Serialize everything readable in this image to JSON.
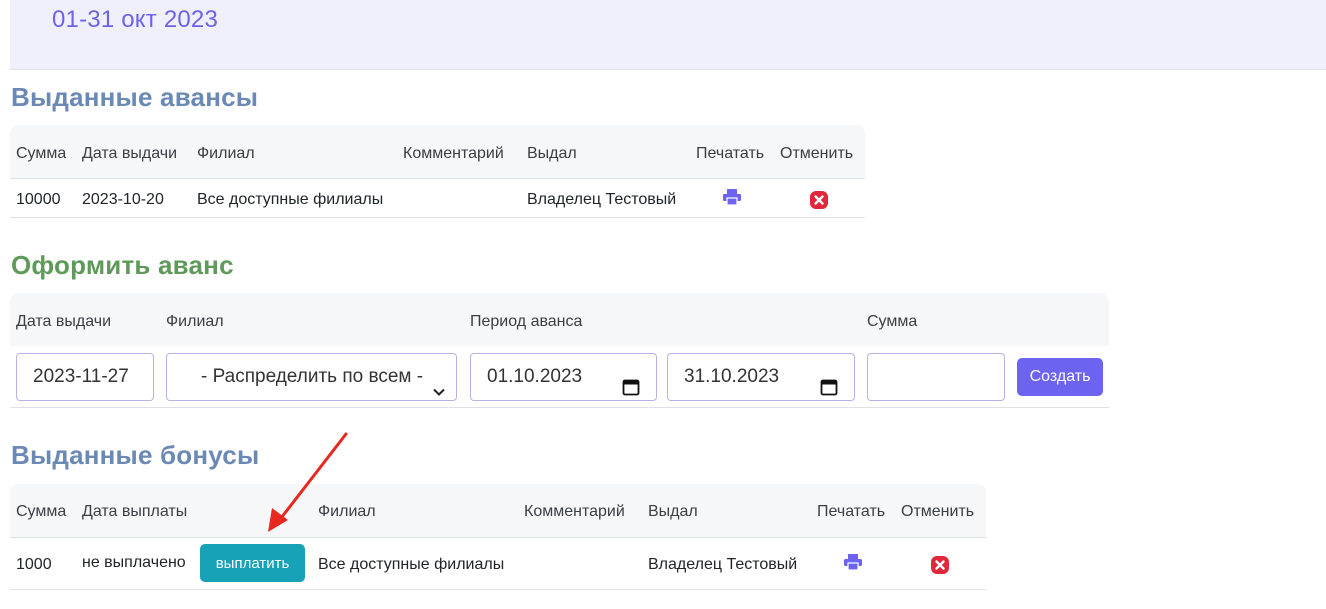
{
  "period": {
    "title": "01-31 окт 2023"
  },
  "advances_issued": {
    "title": "Выданные авансы",
    "columns": [
      "Сумма",
      "Дата выдачи",
      "Филиал",
      "Комментарий",
      "Выдал",
      "Печатать",
      "Отменить"
    ],
    "rows": [
      {
        "amount": "10000",
        "date": "2023-10-20",
        "branch": "Все доступные филиалы",
        "comment": "",
        "issued_by": "Владелец Тестовый",
        "print_icon": "print-icon",
        "cancel_icon": "cancel-icon"
      }
    ]
  },
  "create_advance": {
    "title": "Оформить аванс",
    "columns": [
      "Дата выдачи",
      "Филиал",
      "Период аванса",
      "Сумма"
    ],
    "date_value": "2023-11-27",
    "branch_selected": "- Распределить по всем -",
    "period_from": "01.10.2023",
    "period_to": "31.10.2023",
    "amount_value": "",
    "submit_label": "Создать"
  },
  "bonuses_issued": {
    "title": "Выданные бонусы",
    "columns": [
      "Сумма",
      "Дата выплаты",
      "Филиал",
      "Комментарий",
      "Выдал",
      "Печатать",
      "Отменить"
    ],
    "rows": [
      {
        "amount": "1000",
        "status": "не выплачено",
        "pay_label": "выплатить",
        "branch": "Все доступные филиалы",
        "comment": "",
        "issued_by": "Владелец Тестовый",
        "print_icon": "print-icon",
        "cancel_icon": "cancel-icon"
      }
    ]
  },
  "colors": {
    "accent": "#6c63f0",
    "title_blue": "#6a89b4",
    "title_green": "#5f9a5a",
    "pay_button": "#17a2b8",
    "cancel_red": "#e0283a",
    "annotation_arrow": "#e8271f"
  }
}
